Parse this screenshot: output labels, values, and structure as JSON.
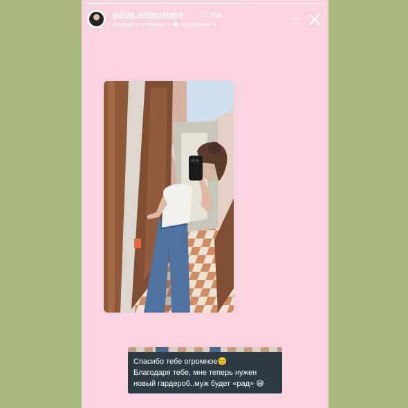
{
  "story": {
    "username": "yuliya_romenskaya",
    "time_ago": "22 год",
    "highlight_prefix": "Додано у вибране «",
    "highlight_badge_text": "TOP",
    "highlight_name": "схуднення",
    "highlight_suffix": "»",
    "highlight_chevron": "›",
    "progress_segments": 3,
    "current_segment": 1
  },
  "message": {
    "line1": "Спасибо тебе огромное☺️",
    "line2": "Благодаря тебе, мне теперь нужен",
    "line3": "новый гардероб..муж будет «рад» 😅"
  },
  "colors": {
    "page_bg": "#aab97e",
    "story_bg": "#f9d3df",
    "chat_bg": "#2b3a43"
  },
  "icons": {
    "more": "more-horizontal-icon",
    "close": "close-icon",
    "chevron": "chevron-right-icon"
  }
}
